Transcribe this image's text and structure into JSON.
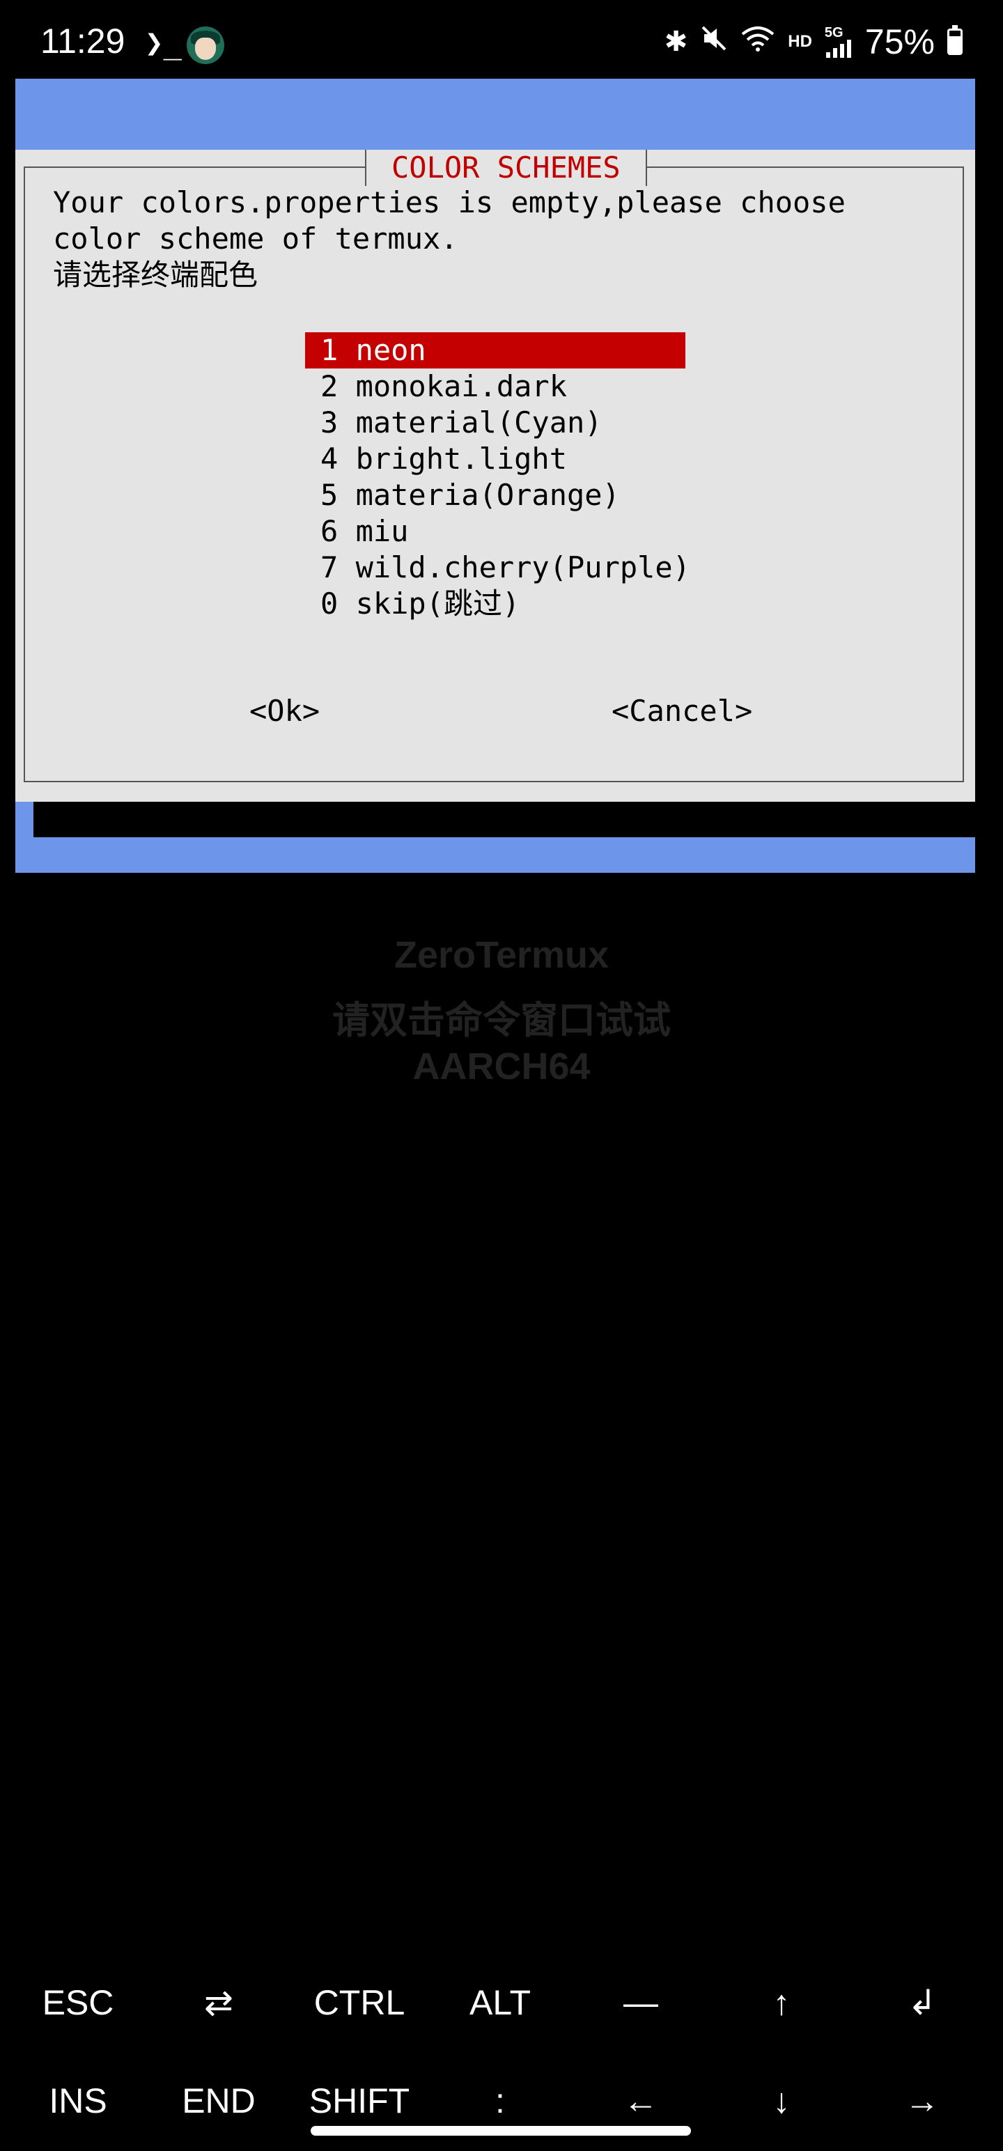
{
  "status_bar": {
    "time": "11:29",
    "terminal_glyph": "❯_",
    "bluetooth_glyph": "✱",
    "mute_glyph": "🔇",
    "wifi_glyph": "📶",
    "hd_label": "HD",
    "network_label": "5G",
    "signal_glyph": "▂▄▆",
    "battery_percent": "75%",
    "battery_level": 0.75
  },
  "dialog": {
    "title": "COLOR SCHEMES",
    "message_line1": "Your colors.properties is empty,please choose",
    "message_line2": "color scheme of termux.",
    "message_line3": "请选择终端配色",
    "items": [
      {
        "label": "1 neon",
        "selected": true
      },
      {
        "label": "2 monokai.dark",
        "selected": false
      },
      {
        "label": "3 material(Cyan)",
        "selected": false
      },
      {
        "label": "4 bright.light",
        "selected": false
      },
      {
        "label": "5 materia(Orange)",
        "selected": false
      },
      {
        "label": "6 miu",
        "selected": false
      },
      {
        "label": "7 wild.cherry(Purple)",
        "selected": false
      },
      {
        "label": "0 skip(跳过)",
        "selected": false
      }
    ],
    "ok_label": "<Ok>",
    "cancel_label": "<Cancel>"
  },
  "watermark": {
    "line1": "ZeroTermux",
    "line2": "请双击命令窗口试试",
    "line3": "AARCH64"
  },
  "extra_keys": {
    "row1": [
      "ESC",
      "⇄",
      "CTRL",
      "ALT",
      "—",
      "↑",
      "↲"
    ],
    "row2": [
      "INS",
      "END",
      "SHIFT",
      ":",
      "←",
      "↓",
      "→"
    ]
  },
  "colors": {
    "accent_blue": "#6d96ea",
    "dialog_bg": "#e4e4e4",
    "highlight_red": "#c40000",
    "title_red": "#c00000"
  }
}
